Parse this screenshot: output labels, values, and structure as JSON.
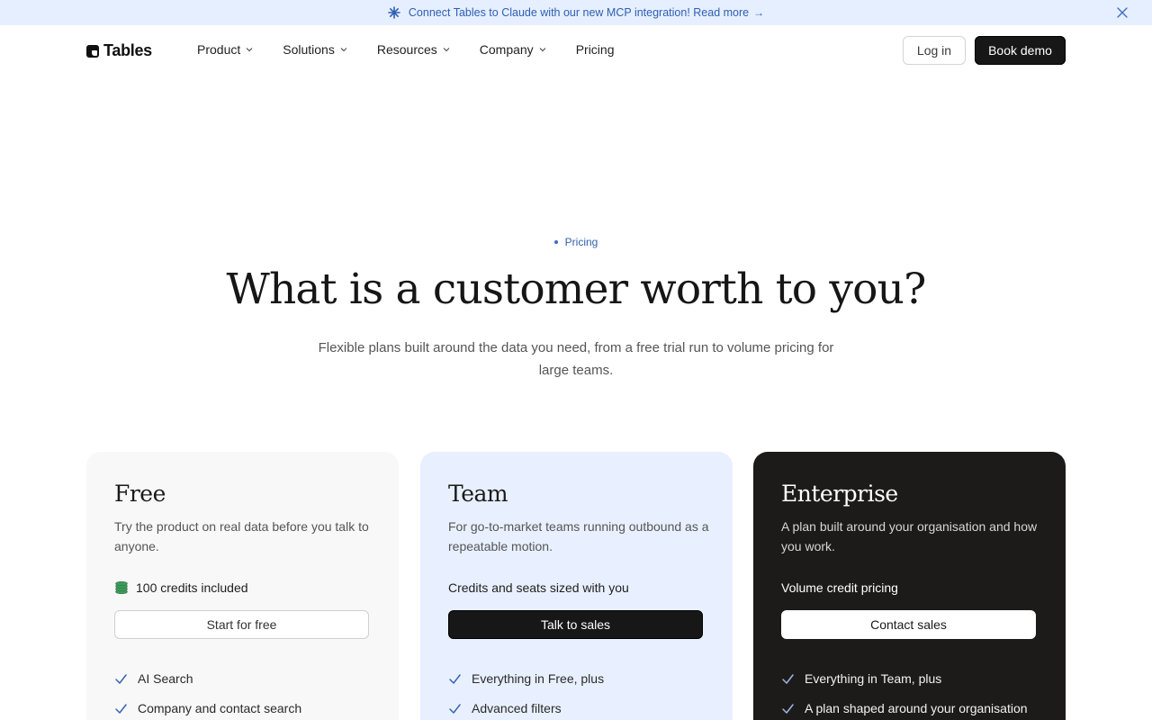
{
  "announcement": {
    "text": "Connect Tables to Claude with our new MCP integration! Read more",
    "arrow": "→",
    "icons": {
      "spark": "sparkle-icon",
      "close": "close-icon"
    }
  },
  "nav": {
    "brand": "Tables",
    "menu": [
      {
        "label": "Product",
        "dropdown": true
      },
      {
        "label": "Solutions",
        "dropdown": true
      },
      {
        "label": "Resources",
        "dropdown": true
      },
      {
        "label": "Company",
        "dropdown": true
      },
      {
        "label": "Pricing",
        "dropdown": false
      }
    ],
    "login_label": "Log in",
    "demo_label": "Book demo"
  },
  "hero": {
    "eyebrow": "Pricing",
    "title": "What is a customer worth to you?",
    "subtitle": "Flexible plans built around the data you need, from a free trial run to volume pricing for large teams."
  },
  "plans": [
    {
      "name": "Free",
      "description": "Try the product on real data before you talk to anyone.",
      "offer": "100 credits included",
      "offer_icon": "coins-icon",
      "cta": "Start for free",
      "features": [
        "AI Search",
        "Company and contact search"
      ]
    },
    {
      "name": "Team",
      "description": "For go-to-market teams running outbound as a repeatable motion.",
      "offer": "Credits and seats sized with you",
      "cta": "Talk to sales",
      "features": [
        "Everything in Free, plus",
        "Advanced filters"
      ]
    },
    {
      "name": "Enterprise",
      "description": "A plan built around your organisation and how you work.",
      "offer": "Volume credit pricing",
      "cta": "Contact sales",
      "features": [
        "Everything in Team, plus",
        "A plan shaped around your organisation"
      ]
    }
  ],
  "colors": {
    "announcement_bg": "#e6efff",
    "accent_blue": "#2e5fb3",
    "team_card_bg": "#e8f0ff",
    "enterprise_card_bg": "#1c1b19",
    "free_card_bg": "#f8f8f8",
    "primary_button": "#171717"
  }
}
